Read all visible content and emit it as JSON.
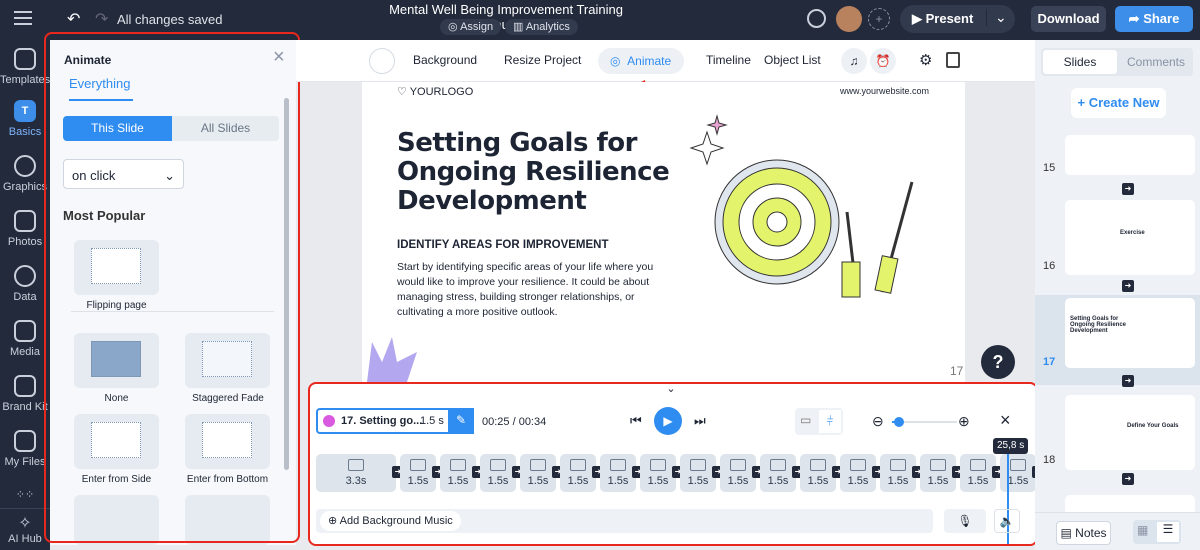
{
  "topbar": {
    "save_status": "All changes saved",
    "title": "Mental Well Being Improvement Training Course",
    "assign": "Assign",
    "analytics": "Analytics",
    "present": "Present",
    "download": "Download",
    "share": "Share"
  },
  "rail": [
    {
      "label": "Templates"
    },
    {
      "label": "Basics"
    },
    {
      "label": "Graphics"
    },
    {
      "label": "Photos"
    },
    {
      "label": "Data"
    },
    {
      "label": "Media"
    },
    {
      "label": "Brand Kit"
    },
    {
      "label": "My Files"
    },
    {
      "label": "AI Hub"
    }
  ],
  "panel": {
    "title": "Animate",
    "tab": "Everything",
    "seg_this": "This Slide",
    "seg_all": "All Slides",
    "trigger": "on click",
    "section": "Most Popular",
    "effects": [
      {
        "label": "Flipping page"
      },
      {
        "label": "None"
      },
      {
        "label": "Staggered Fade"
      },
      {
        "label": "Enter from Side"
      },
      {
        "label": "Enter from Bottom"
      }
    ]
  },
  "toolbar": {
    "background": "Background",
    "resize": "Resize Project",
    "animate": "Animate",
    "timeline": "Timeline",
    "object_list": "Object List"
  },
  "slide": {
    "logo": "YOURLOGO",
    "website": "www.yourwebsite.com",
    "title_l1": "Setting Goals for",
    "title_l2": "Ongoing Resilience",
    "title_l3": "Development",
    "subheading": "IDENTIFY AREAS FOR IMPROVEMENT",
    "body": "Start by identifying specific areas of your life where you would like to improve your resilience. It could be about managing stress, building stronger relationships, or cultivating a more positive outlook.",
    "page_number": "17",
    "help": "?"
  },
  "timeline": {
    "current_slide": "17. Setting go...",
    "current_duration": "1.5 s",
    "time": "00:25 / 00:34",
    "playhead": "25,8 s",
    "add_music": "Add Background Music",
    "clips": [
      "3.3s",
      "1.5s",
      "1.5s",
      "1.5s",
      "1.5s",
      "1.5s",
      "1.5s",
      "1.5s",
      "1.5s",
      "1.5s",
      "1.5s",
      "1.5s",
      "1.5s",
      "1.5s",
      "1.5s",
      "1.5s",
      "1.5s"
    ],
    "active_clip": "1.5s",
    "zoom_level": 0.1
  },
  "right": {
    "tab_slides": "Slides",
    "tab_comments": "Comments",
    "create_new": "+ Create New",
    "notes": "Notes",
    "slides": [
      {
        "num": "15"
      },
      {
        "num": "16",
        "title": "Exercise"
      },
      {
        "num": "17",
        "title": "Setting Goals for Ongoing Resilience Development"
      },
      {
        "num": "18",
        "title": "Define Your Goals"
      }
    ]
  },
  "colors": {
    "accent": "#2f8cf0",
    "dark": "#232a3b",
    "highlight": "#e8271e",
    "clip_active": "#d95ae0"
  }
}
